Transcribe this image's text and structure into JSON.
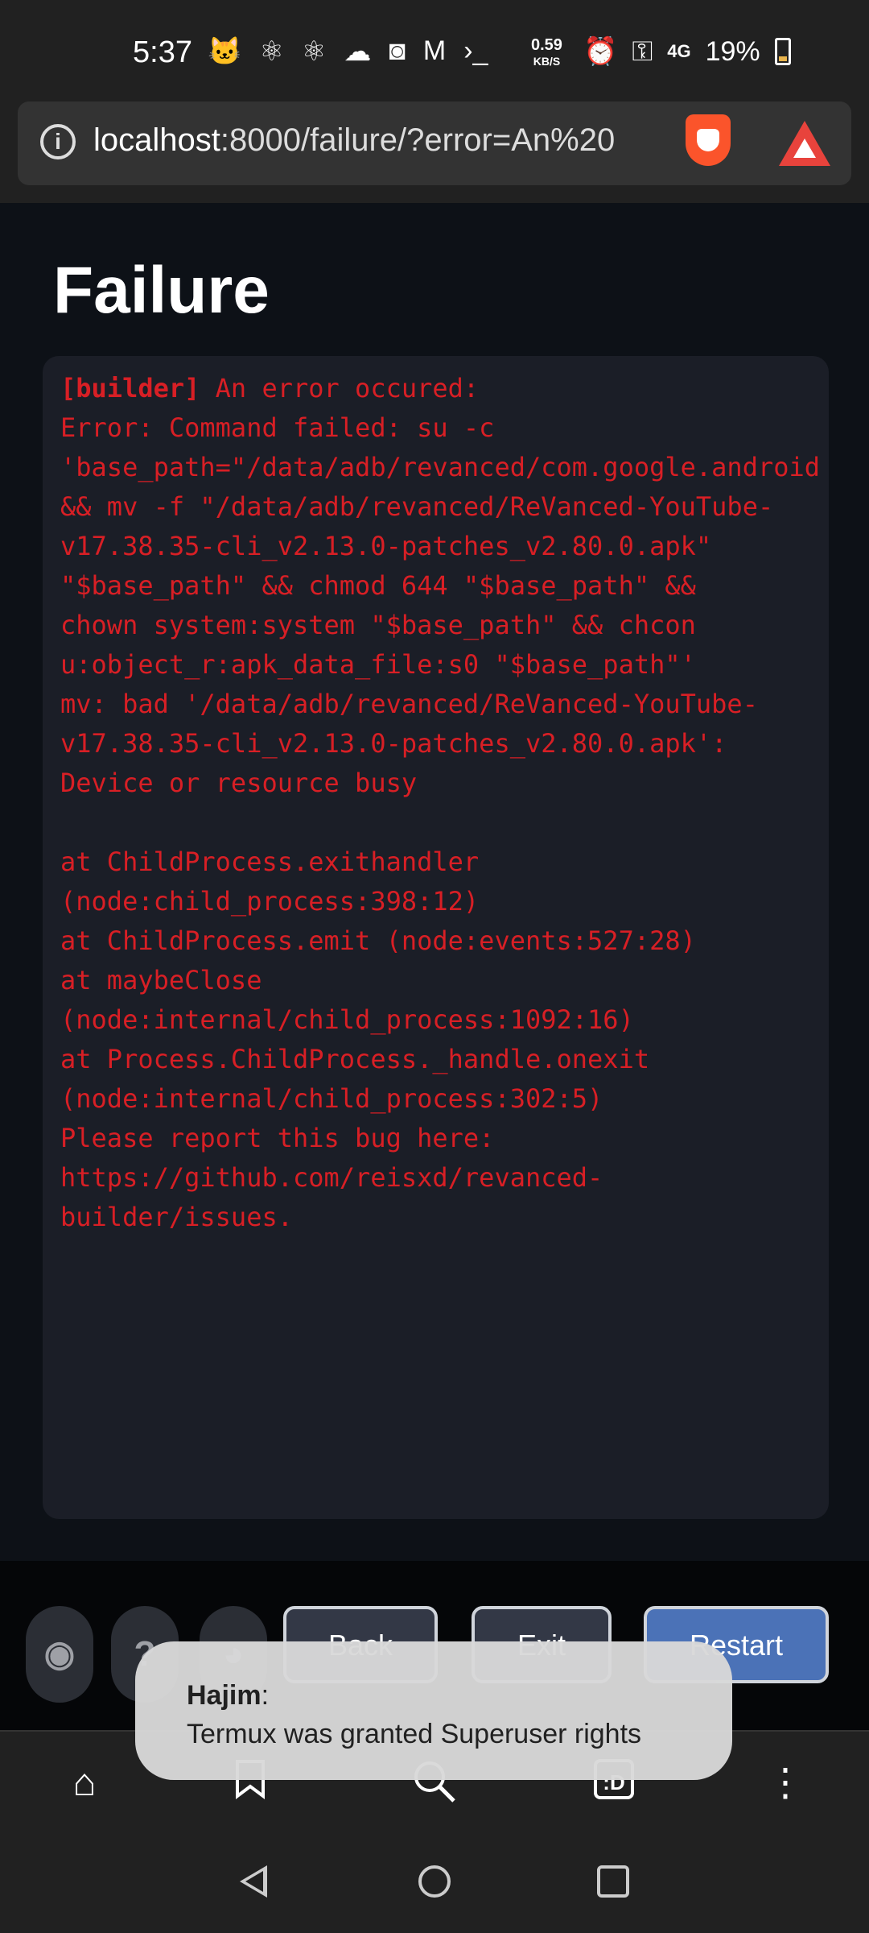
{
  "status_bar": {
    "time": "5:37",
    "net_speed_value": "0.59",
    "net_speed_unit": "KB/S",
    "network": "4G",
    "battery": "19%",
    "icons": [
      "cat-face-icon",
      "atom-icon",
      "atom-icon",
      "cloud-icon",
      "instagram-icon",
      "gmail-icon",
      "terminal-icon",
      "alarm-icon",
      "key-icon",
      "signal-icon",
      "battery-charging-icon"
    ]
  },
  "url_bar": {
    "host": "localhost",
    "rest": ":8000/failure/?error=An%20"
  },
  "page": {
    "title": "Failure",
    "error_tag": "[builder]",
    "error_lines": [
      " An error occured:",
      "Error: Command failed: su -c",
      "'base_path=\"/data/adb/revanced/com.google.android",
      "&& mv -f \"/data/adb/revanced/ReVanced-YouTube-",
      "v17.38.35-cli_v2.13.0-patches_v2.80.0.apk\"",
      "\"$base_path\" && chmod 644 \"$base_path\" &&",
      "chown system:system \"$base_path\" && chcon",
      "u:object_r:apk_data_file:s0 \"$base_path\"'",
      "mv: bad '/data/adb/revanced/ReVanced-YouTube-",
      "v17.38.35-cli_v2.13.0-patches_v2.80.0.apk':",
      "Device or resource busy",
      "",
      "at ChildProcess.exithandler",
      "(node:child_process:398:12)",
      "at ChildProcess.emit (node:events:527:28)",
      "at maybeClose",
      "(node:internal/child_process:1092:16)",
      "at Process.ChildProcess._handle.onexit",
      "(node:internal/child_process:302:5)",
      "Please report this bug here:",
      "https://github.com/reisxd/revanced-",
      "builder/issues."
    ]
  },
  "controls": {
    "back": "Back",
    "exit": "Exit",
    "restart": "Restart"
  },
  "toast": {
    "title": "Hajim",
    "colon": ":",
    "message": "Termux was granted Superuser rights"
  },
  "bottom_nav": [
    "home-icon",
    "bookmark-icon",
    "search-icon",
    "tabs-icon",
    "menu-icon"
  ],
  "tabs_icon_label": ":D"
}
